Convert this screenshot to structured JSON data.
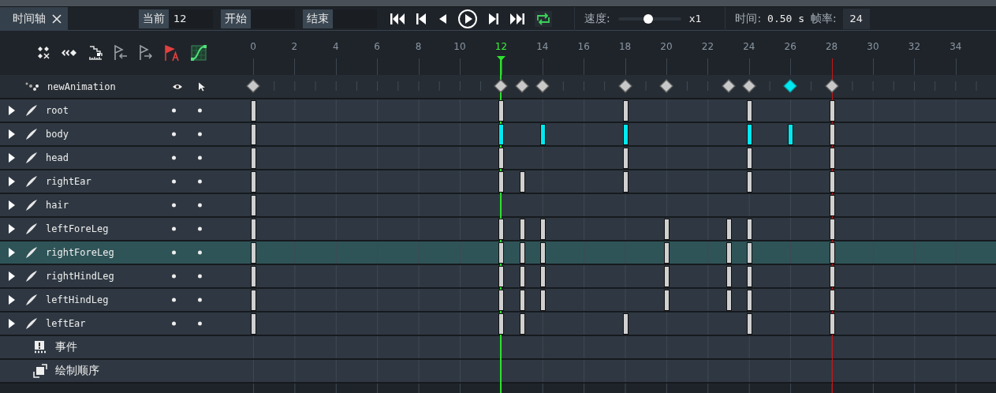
{
  "tab": {
    "label": "时间轴"
  },
  "toolbar": {
    "current_label": "当前",
    "current_value": "12",
    "start_label": "开始",
    "end_label": "结束",
    "loop": {
      "on": true
    },
    "speed_label": "速度:",
    "speed": {
      "level": 0.48
    },
    "speed_value": "x1",
    "time_label": "时间:",
    "time_value": "0.50 s",
    "fps_label": "帧率:",
    "fps_value": "24"
  },
  "timeline": {
    "ticks": [
      "0",
      "2",
      "4",
      "6",
      "8",
      "10",
      "12",
      "14",
      "16",
      "18",
      "20",
      "22",
      "24",
      "26",
      "28",
      "30",
      "32",
      "34"
    ],
    "animation": {
      "name": "newAnimation",
      "frames": [
        {
          "kind": "key"
        },
        {
          "kind": "none"
        },
        {
          "kind": "none"
        },
        {
          "kind": "none"
        },
        {
          "kind": "none"
        },
        {
          "kind": "none"
        },
        {
          "kind": "none"
        },
        {
          "kind": "none"
        },
        {
          "kind": "none"
        },
        {
          "kind": "none"
        },
        {
          "kind": "none"
        },
        {
          "kind": "none"
        },
        {
          "kind": "key"
        },
        {
          "kind": "key"
        },
        {
          "kind": "key"
        },
        {
          "kind": "none"
        },
        {
          "kind": "none"
        },
        {
          "kind": "none"
        },
        {
          "kind": "key"
        },
        {
          "kind": "none"
        },
        {
          "kind": "key"
        },
        {
          "kind": "none"
        },
        {
          "kind": "none"
        },
        {
          "kind": "key"
        },
        {
          "kind": "key"
        },
        {
          "kind": "none"
        },
        {
          "kind": "selected_key"
        },
        {
          "kind": "none"
        },
        {
          "kind": "end_key"
        }
      ]
    },
    "bones": [
      {
        "name": "root",
        "selected": false,
        "frames": [
          {
            "kind": "key"
          },
          {
            "kind": "none"
          },
          {
            "kind": "none"
          },
          {
            "kind": "none"
          },
          {
            "kind": "none"
          },
          {
            "kind": "none"
          },
          {
            "kind": "none"
          },
          {
            "kind": "none"
          },
          {
            "kind": "none"
          },
          {
            "kind": "none"
          },
          {
            "kind": "none"
          },
          {
            "kind": "none"
          },
          {
            "kind": "key"
          },
          {
            "kind": "none"
          },
          {
            "kind": "none"
          },
          {
            "kind": "none"
          },
          {
            "kind": "none"
          },
          {
            "kind": "none"
          },
          {
            "kind": "key"
          },
          {
            "kind": "none"
          },
          {
            "kind": "none"
          },
          {
            "kind": "none"
          },
          {
            "kind": "none"
          },
          {
            "kind": "none"
          },
          {
            "kind": "key"
          },
          {
            "kind": "none"
          },
          {
            "kind": "none"
          },
          {
            "kind": "none"
          },
          {
            "kind": "key"
          }
        ]
      },
      {
        "name": "body",
        "selected": false,
        "frames": [
          {
            "kind": "key"
          },
          {
            "kind": "none"
          },
          {
            "kind": "none"
          },
          {
            "kind": "none"
          },
          {
            "kind": "none"
          },
          {
            "kind": "none"
          },
          {
            "kind": "none"
          },
          {
            "kind": "none"
          },
          {
            "kind": "none"
          },
          {
            "kind": "none"
          },
          {
            "kind": "none"
          },
          {
            "kind": "none"
          },
          {
            "kind": "selected_key"
          },
          {
            "kind": "none"
          },
          {
            "kind": "selected_key"
          },
          {
            "kind": "none"
          },
          {
            "kind": "none"
          },
          {
            "kind": "none"
          },
          {
            "kind": "selected_key"
          },
          {
            "kind": "none"
          },
          {
            "kind": "none"
          },
          {
            "kind": "none"
          },
          {
            "kind": "none"
          },
          {
            "kind": "none"
          },
          {
            "kind": "selected_key"
          },
          {
            "kind": "none"
          },
          {
            "kind": "selected_key"
          },
          {
            "kind": "none"
          },
          {
            "kind": "key"
          }
        ]
      },
      {
        "name": "head",
        "selected": false,
        "frames": [
          {
            "kind": "key"
          },
          {
            "kind": "none"
          },
          {
            "kind": "none"
          },
          {
            "kind": "none"
          },
          {
            "kind": "none"
          },
          {
            "kind": "none"
          },
          {
            "kind": "none"
          },
          {
            "kind": "none"
          },
          {
            "kind": "none"
          },
          {
            "kind": "none"
          },
          {
            "kind": "none"
          },
          {
            "kind": "none"
          },
          {
            "kind": "key"
          },
          {
            "kind": "none"
          },
          {
            "kind": "none"
          },
          {
            "kind": "none"
          },
          {
            "kind": "none"
          },
          {
            "kind": "none"
          },
          {
            "kind": "key"
          },
          {
            "kind": "none"
          },
          {
            "kind": "none"
          },
          {
            "kind": "none"
          },
          {
            "kind": "none"
          },
          {
            "kind": "none"
          },
          {
            "kind": "key"
          },
          {
            "kind": "none"
          },
          {
            "kind": "none"
          },
          {
            "kind": "none"
          },
          {
            "kind": "key"
          }
        ]
      },
      {
        "name": "rightEar",
        "selected": false,
        "frames": [
          {
            "kind": "key"
          },
          {
            "kind": "none"
          },
          {
            "kind": "none"
          },
          {
            "kind": "none"
          },
          {
            "kind": "none"
          },
          {
            "kind": "none"
          },
          {
            "kind": "none"
          },
          {
            "kind": "none"
          },
          {
            "kind": "none"
          },
          {
            "kind": "none"
          },
          {
            "kind": "none"
          },
          {
            "kind": "none"
          },
          {
            "kind": "key"
          },
          {
            "kind": "key"
          },
          {
            "kind": "none"
          },
          {
            "kind": "none"
          },
          {
            "kind": "none"
          },
          {
            "kind": "none"
          },
          {
            "kind": "key"
          },
          {
            "kind": "none"
          },
          {
            "kind": "none"
          },
          {
            "kind": "none"
          },
          {
            "kind": "none"
          },
          {
            "kind": "none"
          },
          {
            "kind": "key"
          },
          {
            "kind": "none"
          },
          {
            "kind": "none"
          },
          {
            "kind": "none"
          },
          {
            "kind": "key"
          }
        ]
      },
      {
        "name": "hair",
        "selected": false,
        "frames": [
          {
            "kind": "key"
          },
          {
            "kind": "none"
          },
          {
            "kind": "none"
          },
          {
            "kind": "none"
          },
          {
            "kind": "none"
          },
          {
            "kind": "none"
          },
          {
            "kind": "none"
          },
          {
            "kind": "none"
          },
          {
            "kind": "none"
          },
          {
            "kind": "none"
          },
          {
            "kind": "none"
          },
          {
            "kind": "none"
          },
          {
            "kind": "none"
          },
          {
            "kind": "none"
          },
          {
            "kind": "none"
          },
          {
            "kind": "none"
          },
          {
            "kind": "none"
          },
          {
            "kind": "none"
          },
          {
            "kind": "none"
          },
          {
            "kind": "none"
          },
          {
            "kind": "none"
          },
          {
            "kind": "none"
          },
          {
            "kind": "none"
          },
          {
            "kind": "none"
          },
          {
            "kind": "none"
          },
          {
            "kind": "none"
          },
          {
            "kind": "none"
          },
          {
            "kind": "none"
          },
          {
            "kind": "key"
          }
        ]
      },
      {
        "name": "leftForeLeg",
        "selected": false,
        "frames": [
          {
            "kind": "key"
          },
          {
            "kind": "none"
          },
          {
            "kind": "none"
          },
          {
            "kind": "none"
          },
          {
            "kind": "none"
          },
          {
            "kind": "none"
          },
          {
            "kind": "none"
          },
          {
            "kind": "none"
          },
          {
            "kind": "none"
          },
          {
            "kind": "none"
          },
          {
            "kind": "none"
          },
          {
            "kind": "none"
          },
          {
            "kind": "key"
          },
          {
            "kind": "key"
          },
          {
            "kind": "key"
          },
          {
            "kind": "none"
          },
          {
            "kind": "none"
          },
          {
            "kind": "none"
          },
          {
            "kind": "none"
          },
          {
            "kind": "none"
          },
          {
            "kind": "key"
          },
          {
            "kind": "none"
          },
          {
            "kind": "none"
          },
          {
            "kind": "key"
          },
          {
            "kind": "key"
          },
          {
            "kind": "none"
          },
          {
            "kind": "none"
          },
          {
            "kind": "none"
          },
          {
            "kind": "key"
          }
        ]
      },
      {
        "name": "rightForeLeg",
        "selected": true,
        "frames": [
          {
            "kind": "key"
          },
          {
            "kind": "none"
          },
          {
            "kind": "none"
          },
          {
            "kind": "none"
          },
          {
            "kind": "none"
          },
          {
            "kind": "none"
          },
          {
            "kind": "none"
          },
          {
            "kind": "none"
          },
          {
            "kind": "none"
          },
          {
            "kind": "none"
          },
          {
            "kind": "none"
          },
          {
            "kind": "none"
          },
          {
            "kind": "key"
          },
          {
            "kind": "key"
          },
          {
            "kind": "key"
          },
          {
            "kind": "none"
          },
          {
            "kind": "none"
          },
          {
            "kind": "none"
          },
          {
            "kind": "none"
          },
          {
            "kind": "none"
          },
          {
            "kind": "key"
          },
          {
            "kind": "none"
          },
          {
            "kind": "none"
          },
          {
            "kind": "key"
          },
          {
            "kind": "key"
          },
          {
            "kind": "none"
          },
          {
            "kind": "none"
          },
          {
            "kind": "none"
          },
          {
            "kind": "key"
          }
        ]
      },
      {
        "name": "rightHindLeg",
        "selected": false,
        "frames": [
          {
            "kind": "key"
          },
          {
            "kind": "none"
          },
          {
            "kind": "none"
          },
          {
            "kind": "none"
          },
          {
            "kind": "none"
          },
          {
            "kind": "none"
          },
          {
            "kind": "none"
          },
          {
            "kind": "none"
          },
          {
            "kind": "none"
          },
          {
            "kind": "none"
          },
          {
            "kind": "none"
          },
          {
            "kind": "none"
          },
          {
            "kind": "key"
          },
          {
            "kind": "key"
          },
          {
            "kind": "key"
          },
          {
            "kind": "none"
          },
          {
            "kind": "none"
          },
          {
            "kind": "none"
          },
          {
            "kind": "none"
          },
          {
            "kind": "none"
          },
          {
            "kind": "key"
          },
          {
            "kind": "none"
          },
          {
            "kind": "none"
          },
          {
            "kind": "key"
          },
          {
            "kind": "key"
          },
          {
            "kind": "none"
          },
          {
            "kind": "none"
          },
          {
            "kind": "none"
          },
          {
            "kind": "key"
          }
        ]
      },
      {
        "name": "leftHindLeg",
        "selected": false,
        "frames": [
          {
            "kind": "key"
          },
          {
            "kind": "none"
          },
          {
            "kind": "none"
          },
          {
            "kind": "none"
          },
          {
            "kind": "none"
          },
          {
            "kind": "none"
          },
          {
            "kind": "none"
          },
          {
            "kind": "none"
          },
          {
            "kind": "none"
          },
          {
            "kind": "none"
          },
          {
            "kind": "none"
          },
          {
            "kind": "none"
          },
          {
            "kind": "key"
          },
          {
            "kind": "key"
          },
          {
            "kind": "key"
          },
          {
            "kind": "none"
          },
          {
            "kind": "none"
          },
          {
            "kind": "none"
          },
          {
            "kind": "none"
          },
          {
            "kind": "none"
          },
          {
            "kind": "key"
          },
          {
            "kind": "none"
          },
          {
            "kind": "none"
          },
          {
            "kind": "key"
          },
          {
            "kind": "key"
          },
          {
            "kind": "none"
          },
          {
            "kind": "none"
          },
          {
            "kind": "none"
          },
          {
            "kind": "key"
          }
        ]
      },
      {
        "name": "leftEar",
        "selected": false,
        "frames": [
          {
            "kind": "key"
          },
          {
            "kind": "none"
          },
          {
            "kind": "none"
          },
          {
            "kind": "none"
          },
          {
            "kind": "none"
          },
          {
            "kind": "none"
          },
          {
            "kind": "none"
          },
          {
            "kind": "none"
          },
          {
            "kind": "none"
          },
          {
            "kind": "none"
          },
          {
            "kind": "none"
          },
          {
            "kind": "none"
          },
          {
            "kind": "key"
          },
          {
            "kind": "key"
          },
          {
            "kind": "none"
          },
          {
            "kind": "none"
          },
          {
            "kind": "none"
          },
          {
            "kind": "none"
          },
          {
            "kind": "key"
          },
          {
            "kind": "none"
          },
          {
            "kind": "none"
          },
          {
            "kind": "none"
          },
          {
            "kind": "none"
          },
          {
            "kind": "none"
          },
          {
            "kind": "key"
          },
          {
            "kind": "none"
          },
          {
            "kind": "none"
          },
          {
            "kind": "none"
          },
          {
            "kind": "key"
          }
        ]
      }
    ],
    "extras": [
      {
        "kind": "events",
        "label": "事件"
      },
      {
        "kind": "draw_order",
        "label": "绘制顺序"
      }
    ]
  }
}
